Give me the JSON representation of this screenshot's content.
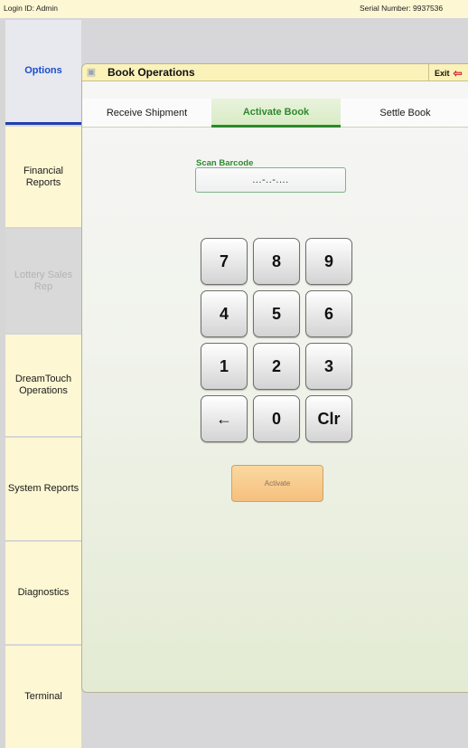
{
  "topbar": {
    "login": "Login ID: Admin",
    "serial": "Serial Number: 9937536"
  },
  "sidebar": {
    "items": [
      {
        "label": "Options"
      },
      {
        "label": "Financial Reports"
      },
      {
        "label": "Lottery Sales Rep"
      },
      {
        "label": "DreamTouch Operations"
      },
      {
        "label": "System Reports"
      },
      {
        "label": "Diagnostics"
      },
      {
        "label": "Terminal"
      }
    ]
  },
  "panel": {
    "header_icon": "book-icon",
    "title": "Book Operations",
    "exit_label": "Exit",
    "exit_icon": "exit-icon"
  },
  "tabs": [
    {
      "label": "Receive Shipment"
    },
    {
      "label": "Activate Book"
    },
    {
      "label": "Settle Book"
    }
  ],
  "scan": {
    "label": "Scan Barcode",
    "value": "...-..-...."
  },
  "keypad": {
    "keys": [
      "7",
      "8",
      "9",
      "4",
      "5",
      "6",
      "1",
      "2",
      "3",
      "←",
      "0",
      "Clr"
    ]
  },
  "actions": {
    "activate_label": "Activate"
  },
  "colors": {
    "accent_green": "#2d8a2d",
    "accent_blue": "#1a4fc9",
    "header_yellow": "#fbf2ba",
    "exit_red": "#d0262b"
  }
}
